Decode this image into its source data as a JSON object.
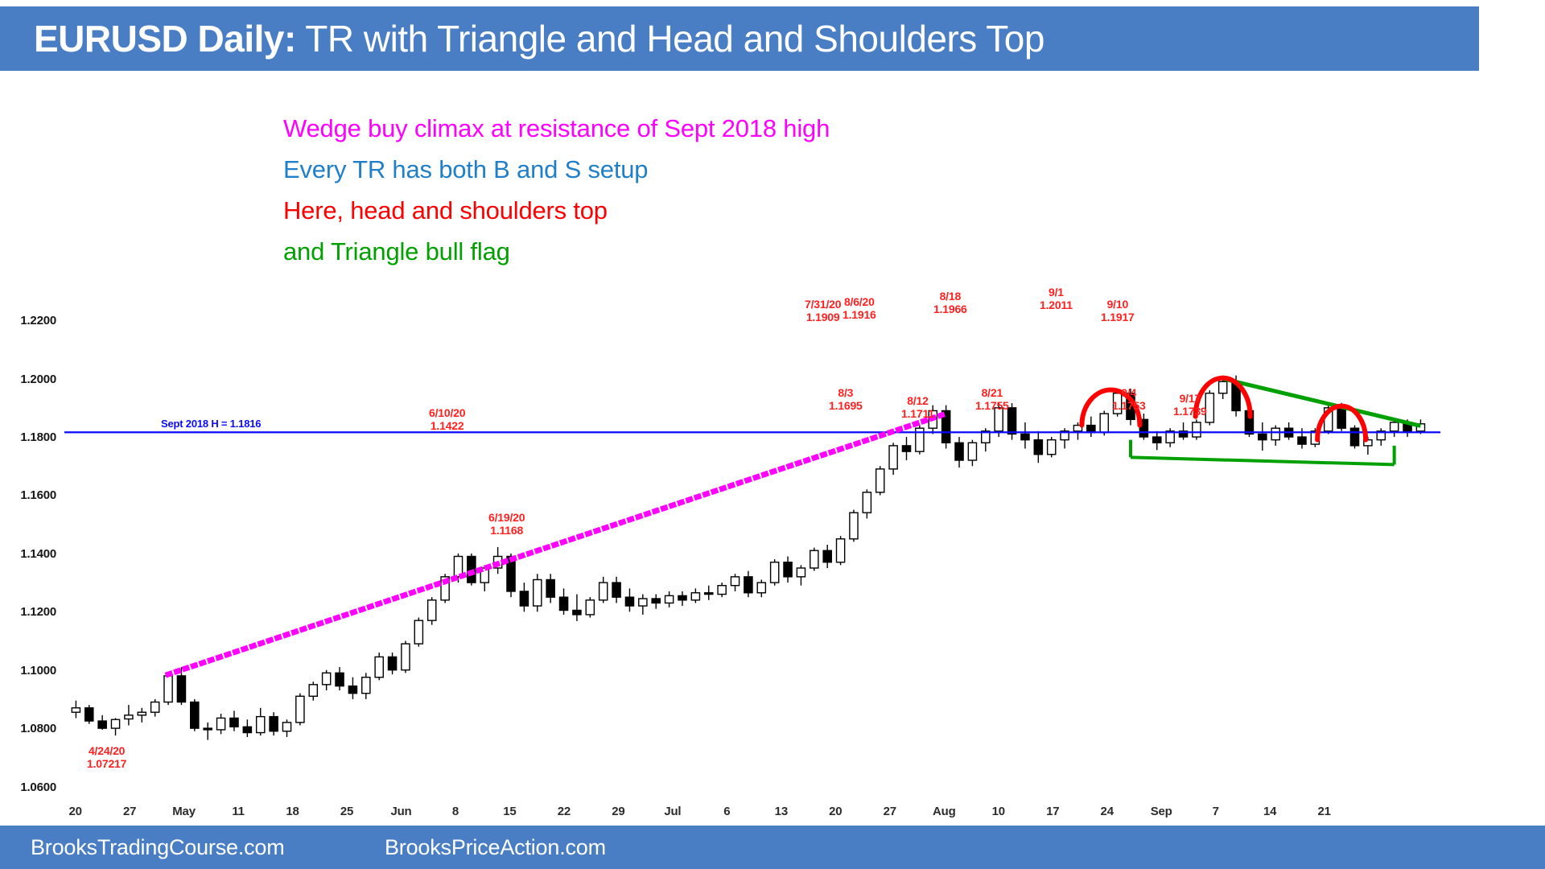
{
  "title": {
    "instrument": "EURUSD Daily:",
    "description": " TR with Triangle and Head and Shoulders Top",
    "banner_color": "#4a7ec4"
  },
  "annotations": [
    {
      "text": "Wedge buy climax at resistance of Sept 2018 high",
      "color": "#ff00ff"
    },
    {
      "text": "Every TR has both B and S setup",
      "color": "#1f7fc8"
    },
    {
      "text": "Here, head and shoulders top",
      "color": "#ff0000"
    },
    {
      "text": "and Triangle bull flag",
      "color": "#00a000"
    }
  ],
  "footer": {
    "link_1": "BrooksTradingCourse.com",
    "link_2": "BrooksPriceAction.com"
  },
  "chart_data": {
    "type": "candlestick",
    "title": "EURUSD Daily: TR with Triangle and Head and Shoulders Top",
    "xlabel": "",
    "ylabel": "",
    "ylim": [
      1.06,
      1.22
    ],
    "grid": false,
    "legend": null,
    "y_ticks": [
      "1.2200",
      "1.2000",
      "1.1800",
      "1.1600",
      "1.1400",
      "1.1200",
      "1.1000",
      "1.0800",
      "1.0600"
    ],
    "y_tick_values": [
      1.22,
      1.2,
      1.18,
      1.16,
      1.14,
      1.12,
      1.1,
      1.08,
      1.06
    ],
    "x_ticks": [
      "20",
      "27",
      "May",
      "11",
      "18",
      "25",
      "Jun",
      "8",
      "15",
      "22",
      "29",
      "Jul",
      "6",
      "13",
      "20",
      "27",
      "Aug",
      "10",
      "17",
      "24",
      "Sep",
      "7",
      "14",
      "21"
    ],
    "horizontal_line": {
      "label": "Sept 2018 H = 1.1816",
      "value": 1.1816,
      "color": "#0a0aff"
    },
    "price_notes": [
      {
        "date": "4/24/20",
        "price": "1.07217"
      },
      {
        "date": "6/10/20",
        "price": "1.1422"
      },
      {
        "date": "6/19/20",
        "price": "1.1168"
      },
      {
        "date": "7/31/20",
        "price": "1.1909"
      },
      {
        "date": "8/6/20",
        "price": "1.1916"
      },
      {
        "date": "8/3",
        "price": "1.1695"
      },
      {
        "date": "8/12",
        "price": "1.1711"
      },
      {
        "date": "8/18",
        "price": "1.1966"
      },
      {
        "date": "8/21",
        "price": "1.1755"
      },
      {
        "date": "9/1",
        "price": "1.2011"
      },
      {
        "date": "9/4",
        "price": "1.1753"
      },
      {
        "date": "9/10",
        "price": "1.1917"
      },
      {
        "date": "9/17",
        "price": "1.1739"
      }
    ],
    "trendlines": [
      {
        "name": "wedge-trendline",
        "color": "#ff00ff",
        "style": "dotted"
      },
      {
        "name": "triangle-upper-trendline",
        "color": "#00a000",
        "style": "solid"
      },
      {
        "name": "triangle-lower-trendline",
        "color": "#00a000",
        "style": "solid"
      }
    ],
    "arcs": [
      {
        "name": "left-shoulder-arc",
        "color": "#ff0000"
      },
      {
        "name": "head-arc",
        "color": "#ff0000"
      },
      {
        "name": "right-shoulder-arc",
        "color": "#ff0000"
      }
    ],
    "candles": [
      {
        "o": 1.0855,
        "h": 1.0895,
        "l": 1.0835,
        "c": 1.087
      },
      {
        "o": 1.087,
        "h": 1.088,
        "l": 1.0815,
        "c": 1.0825
      },
      {
        "o": 1.0825,
        "h": 1.0845,
        "l": 1.0795,
        "c": 1.08
      },
      {
        "o": 1.08,
        "h": 1.0835,
        "l": 1.0775,
        "c": 1.083
      },
      {
        "o": 1.0832,
        "h": 1.088,
        "l": 1.081,
        "c": 1.0845
      },
      {
        "o": 1.0845,
        "h": 1.087,
        "l": 1.082,
        "c": 1.0855
      },
      {
        "o": 1.0855,
        "h": 1.09,
        "l": 1.084,
        "c": 1.089
      },
      {
        "o": 1.089,
        "h": 1.099,
        "l": 1.088,
        "c": 1.098
      },
      {
        "o": 1.098,
        "h": 1.101,
        "l": 1.088,
        "c": 1.089
      },
      {
        "o": 1.089,
        "h": 1.09,
        "l": 1.079,
        "c": 1.08
      },
      {
        "o": 1.08,
        "h": 1.082,
        "l": 1.076,
        "c": 1.0795
      },
      {
        "o": 1.0795,
        "h": 1.085,
        "l": 1.078,
        "c": 1.0835
      },
      {
        "o": 1.0835,
        "h": 1.086,
        "l": 1.079,
        "c": 1.0805
      },
      {
        "o": 1.0805,
        "h": 1.083,
        "l": 1.077,
        "c": 1.0785
      },
      {
        "o": 1.0785,
        "h": 1.087,
        "l": 1.0775,
        "c": 1.084
      },
      {
        "o": 1.084,
        "h": 1.0855,
        "l": 1.0775,
        "c": 1.079
      },
      {
        "o": 1.079,
        "h": 1.083,
        "l": 1.077,
        "c": 1.082
      },
      {
        "o": 1.082,
        "h": 1.092,
        "l": 1.081,
        "c": 1.091
      },
      {
        "o": 1.091,
        "h": 1.096,
        "l": 1.0895,
        "c": 1.095
      },
      {
        "o": 1.095,
        "h": 1.1,
        "l": 1.093,
        "c": 1.099
      },
      {
        "o": 1.099,
        "h": 1.101,
        "l": 1.093,
        "c": 1.0945
      },
      {
        "o": 1.0945,
        "h": 1.0975,
        "l": 1.09,
        "c": 1.092
      },
      {
        "o": 1.092,
        "h": 1.099,
        "l": 1.09,
        "c": 1.0975
      },
      {
        "o": 1.0975,
        "h": 1.106,
        "l": 1.0965,
        "c": 1.1045
      },
      {
        "o": 1.1045,
        "h": 1.106,
        "l": 1.0985,
        "c": 1.1
      },
      {
        "o": 1.1,
        "h": 1.11,
        "l": 1.099,
        "c": 1.109
      },
      {
        "o": 1.109,
        "h": 1.118,
        "l": 1.108,
        "c": 1.117
      },
      {
        "o": 1.117,
        "h": 1.125,
        "l": 1.1155,
        "c": 1.124
      },
      {
        "o": 1.124,
        "h": 1.133,
        "l": 1.123,
        "c": 1.132
      },
      {
        "o": 1.132,
        "h": 1.14,
        "l": 1.13,
        "c": 1.139
      },
      {
        "o": 1.139,
        "h": 1.14,
        "l": 1.129,
        "c": 1.13
      },
      {
        "o": 1.13,
        "h": 1.136,
        "l": 1.127,
        "c": 1.135
      },
      {
        "o": 1.135,
        "h": 1.1422,
        "l": 1.133,
        "c": 1.139
      },
      {
        "o": 1.139,
        "h": 1.14,
        "l": 1.125,
        "c": 1.127
      },
      {
        "o": 1.127,
        "h": 1.13,
        "l": 1.12,
        "c": 1.122
      },
      {
        "o": 1.122,
        "h": 1.133,
        "l": 1.12,
        "c": 1.131
      },
      {
        "o": 1.131,
        "h": 1.133,
        "l": 1.123,
        "c": 1.125
      },
      {
        "o": 1.125,
        "h": 1.128,
        "l": 1.119,
        "c": 1.1205
      },
      {
        "o": 1.1205,
        "h": 1.126,
        "l": 1.1168,
        "c": 1.119
      },
      {
        "o": 1.119,
        "h": 1.125,
        "l": 1.118,
        "c": 1.124
      },
      {
        "o": 1.124,
        "h": 1.132,
        "l": 1.123,
        "c": 1.13
      },
      {
        "o": 1.13,
        "h": 1.132,
        "l": 1.123,
        "c": 1.125
      },
      {
        "o": 1.125,
        "h": 1.128,
        "l": 1.12,
        "c": 1.122
      },
      {
        "o": 1.122,
        "h": 1.126,
        "l": 1.119,
        "c": 1.1245
      },
      {
        "o": 1.1245,
        "h": 1.126,
        "l": 1.121,
        "c": 1.123
      },
      {
        "o": 1.123,
        "h": 1.127,
        "l": 1.1215,
        "c": 1.1255
      },
      {
        "o": 1.1255,
        "h": 1.127,
        "l": 1.122,
        "c": 1.124
      },
      {
        "o": 1.124,
        "h": 1.128,
        "l": 1.123,
        "c": 1.1265
      },
      {
        "o": 1.1265,
        "h": 1.129,
        "l": 1.124,
        "c": 1.126
      },
      {
        "o": 1.126,
        "h": 1.13,
        "l": 1.125,
        "c": 1.129
      },
      {
        "o": 1.129,
        "h": 1.133,
        "l": 1.127,
        "c": 1.132
      },
      {
        "o": 1.132,
        "h": 1.134,
        "l": 1.125,
        "c": 1.1265
      },
      {
        "o": 1.1265,
        "h": 1.131,
        "l": 1.125,
        "c": 1.13
      },
      {
        "o": 1.13,
        "h": 1.138,
        "l": 1.129,
        "c": 1.137
      },
      {
        "o": 1.137,
        "h": 1.139,
        "l": 1.13,
        "c": 1.132
      },
      {
        "o": 1.132,
        "h": 1.136,
        "l": 1.129,
        "c": 1.135
      },
      {
        "o": 1.135,
        "h": 1.142,
        "l": 1.134,
        "c": 1.141
      },
      {
        "o": 1.141,
        "h": 1.143,
        "l": 1.135,
        "c": 1.137
      },
      {
        "o": 1.137,
        "h": 1.146,
        "l": 1.136,
        "c": 1.145
      },
      {
        "o": 1.145,
        "h": 1.155,
        "l": 1.144,
        "c": 1.154
      },
      {
        "o": 1.154,
        "h": 1.162,
        "l": 1.152,
        "c": 1.161
      },
      {
        "o": 1.161,
        "h": 1.17,
        "l": 1.16,
        "c": 1.169
      },
      {
        "o": 1.169,
        "h": 1.178,
        "l": 1.167,
        "c": 1.177
      },
      {
        "o": 1.177,
        "h": 1.18,
        "l": 1.172,
        "c": 1.175
      },
      {
        "o": 1.175,
        "h": 1.184,
        "l": 1.174,
        "c": 1.183
      },
      {
        "o": 1.183,
        "h": 1.1909,
        "l": 1.181,
        "c": 1.189
      },
      {
        "o": 1.189,
        "h": 1.1909,
        "l": 1.176,
        "c": 1.178
      },
      {
        "o": 1.178,
        "h": 1.18,
        "l": 1.1695,
        "c": 1.172
      },
      {
        "o": 1.172,
        "h": 1.179,
        "l": 1.17,
        "c": 1.178
      },
      {
        "o": 1.178,
        "h": 1.183,
        "l": 1.175,
        "c": 1.182
      },
      {
        "o": 1.182,
        "h": 1.1916,
        "l": 1.18,
        "c": 1.19
      },
      {
        "o": 1.19,
        "h": 1.1916,
        "l": 1.179,
        "c": 1.181
      },
      {
        "o": 1.181,
        "h": 1.185,
        "l": 1.176,
        "c": 1.179
      },
      {
        "o": 1.179,
        "h": 1.182,
        "l": 1.1711,
        "c": 1.174
      },
      {
        "o": 1.174,
        "h": 1.18,
        "l": 1.173,
        "c": 1.179
      },
      {
        "o": 1.179,
        "h": 1.183,
        "l": 1.176,
        "c": 1.182
      },
      {
        "o": 1.182,
        "h": 1.185,
        "l": 1.179,
        "c": 1.184
      },
      {
        "o": 1.184,
        "h": 1.187,
        "l": 1.18,
        "c": 1.1815
      },
      {
        "o": 1.1815,
        "h": 1.189,
        "l": 1.1805,
        "c": 1.188
      },
      {
        "o": 1.188,
        "h": 1.1966,
        "l": 1.187,
        "c": 1.195
      },
      {
        "o": 1.195,
        "h": 1.1966,
        "l": 1.184,
        "c": 1.186
      },
      {
        "o": 1.186,
        "h": 1.188,
        "l": 1.179,
        "c": 1.18
      },
      {
        "o": 1.18,
        "h": 1.182,
        "l": 1.1755,
        "c": 1.178
      },
      {
        "o": 1.178,
        "h": 1.183,
        "l": 1.1765,
        "c": 1.182
      },
      {
        "o": 1.182,
        "h": 1.185,
        "l": 1.179,
        "c": 1.18
      },
      {
        "o": 1.18,
        "h": 1.186,
        "l": 1.179,
        "c": 1.185
      },
      {
        "o": 1.185,
        "h": 1.196,
        "l": 1.184,
        "c": 1.195
      },
      {
        "o": 1.195,
        "h": 1.2011,
        "l": 1.193,
        "c": 1.199
      },
      {
        "o": 1.199,
        "h": 1.2011,
        "l": 1.187,
        "c": 1.189
      },
      {
        "o": 1.189,
        "h": 1.19,
        "l": 1.18,
        "c": 1.181
      },
      {
        "o": 1.181,
        "h": 1.185,
        "l": 1.1753,
        "c": 1.179
      },
      {
        "o": 1.179,
        "h": 1.184,
        "l": 1.177,
        "c": 1.183
      },
      {
        "o": 1.183,
        "h": 1.185,
        "l": 1.179,
        "c": 1.18
      },
      {
        "o": 1.18,
        "h": 1.183,
        "l": 1.176,
        "c": 1.1775
      },
      {
        "o": 1.1775,
        "h": 1.183,
        "l": 1.1765,
        "c": 1.182
      },
      {
        "o": 1.182,
        "h": 1.1917,
        "l": 1.181,
        "c": 1.19
      },
      {
        "o": 1.19,
        "h": 1.1917,
        "l": 1.182,
        "c": 1.183
      },
      {
        "o": 1.183,
        "h": 1.184,
        "l": 1.176,
        "c": 1.177
      },
      {
        "o": 1.177,
        "h": 1.18,
        "l": 1.1739,
        "c": 1.179
      },
      {
        "o": 1.179,
        "h": 1.183,
        "l": 1.177,
        "c": 1.182
      },
      {
        "o": 1.182,
        "h": 1.186,
        "l": 1.18,
        "c": 1.185
      },
      {
        "o": 1.185,
        "h": 1.186,
        "l": 1.18,
        "c": 1.182
      },
      {
        "o": 1.182,
        "h": 1.186,
        "l": 1.181,
        "c": 1.1845
      }
    ]
  }
}
